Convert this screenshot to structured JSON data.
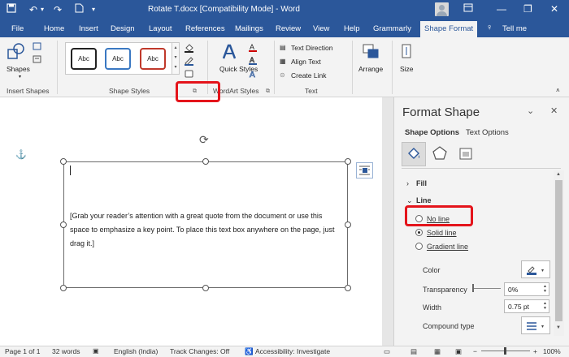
{
  "titlebar": {
    "title": "Rotate T.docx  [Compatibility Mode]  -  Word",
    "window_controls": {
      "minimize": "—",
      "restore": "❐",
      "close": "✕"
    },
    "qat_icons": [
      "save-icon",
      "undo-icon",
      "redo-icon",
      "new-doc-icon",
      "customize-qat-icon"
    ]
  },
  "tabs": [
    "File",
    "Home",
    "Insert",
    "Design",
    "Layout",
    "References",
    "Mailings",
    "Review",
    "View",
    "Help",
    "Grammarly",
    "Shape Format"
  ],
  "active_tab": "Shape Format",
  "tell_me": "Tell me",
  "ribbon": {
    "insert_shapes": {
      "shapes_label": "Shapes",
      "group_label": "Insert Shapes"
    },
    "shape_styles": {
      "samples": [
        {
          "text": "Abc",
          "border": "#222222"
        },
        {
          "text": "Abc",
          "border": "#3a78c2"
        },
        {
          "text": "Abc",
          "border": "#c0392b"
        }
      ],
      "group_label": "Shape Styles"
    },
    "wordart": {
      "quick_styles_label": "Quick Styles",
      "group_label": "WordArt Styles"
    },
    "text": {
      "text_direction": "Text Direction",
      "align_text": "Align Text",
      "create_link": "Create Link",
      "group_label": "Text"
    },
    "arrange_label": "Arrange",
    "size_label": "Size"
  },
  "document": {
    "quote": "[Grab your reader’s attention with a great quote from the document or use this space to emphasize a key point. To place this text box anywhere on the page, just drag it.]"
  },
  "format_pane": {
    "title": "Format Shape",
    "tabs": [
      "Shape Options",
      "Text Options"
    ],
    "sections": {
      "fill": "Fill",
      "line": "Line"
    },
    "line_options": [
      {
        "label": "No line",
        "selected": false
      },
      {
        "label": "Solid line",
        "selected": true
      },
      {
        "label": "Gradient line",
        "selected": false
      }
    ],
    "props": {
      "color": "Color",
      "transparency": "Transparency",
      "transparency_value": "0%",
      "width": "Width",
      "width_value": "0.75 pt",
      "compound_type": "Compound type"
    },
    "colors": {
      "line_color_swatch": "#2b579a"
    }
  },
  "statusbar": {
    "page": "Page 1 of 1",
    "words": "32 words",
    "language": "English (India)",
    "track_changes": "Track Changes: Off",
    "accessibility": "Accessibility: Investigate",
    "zoom": "100%"
  },
  "highlight_color": "#e4141b"
}
